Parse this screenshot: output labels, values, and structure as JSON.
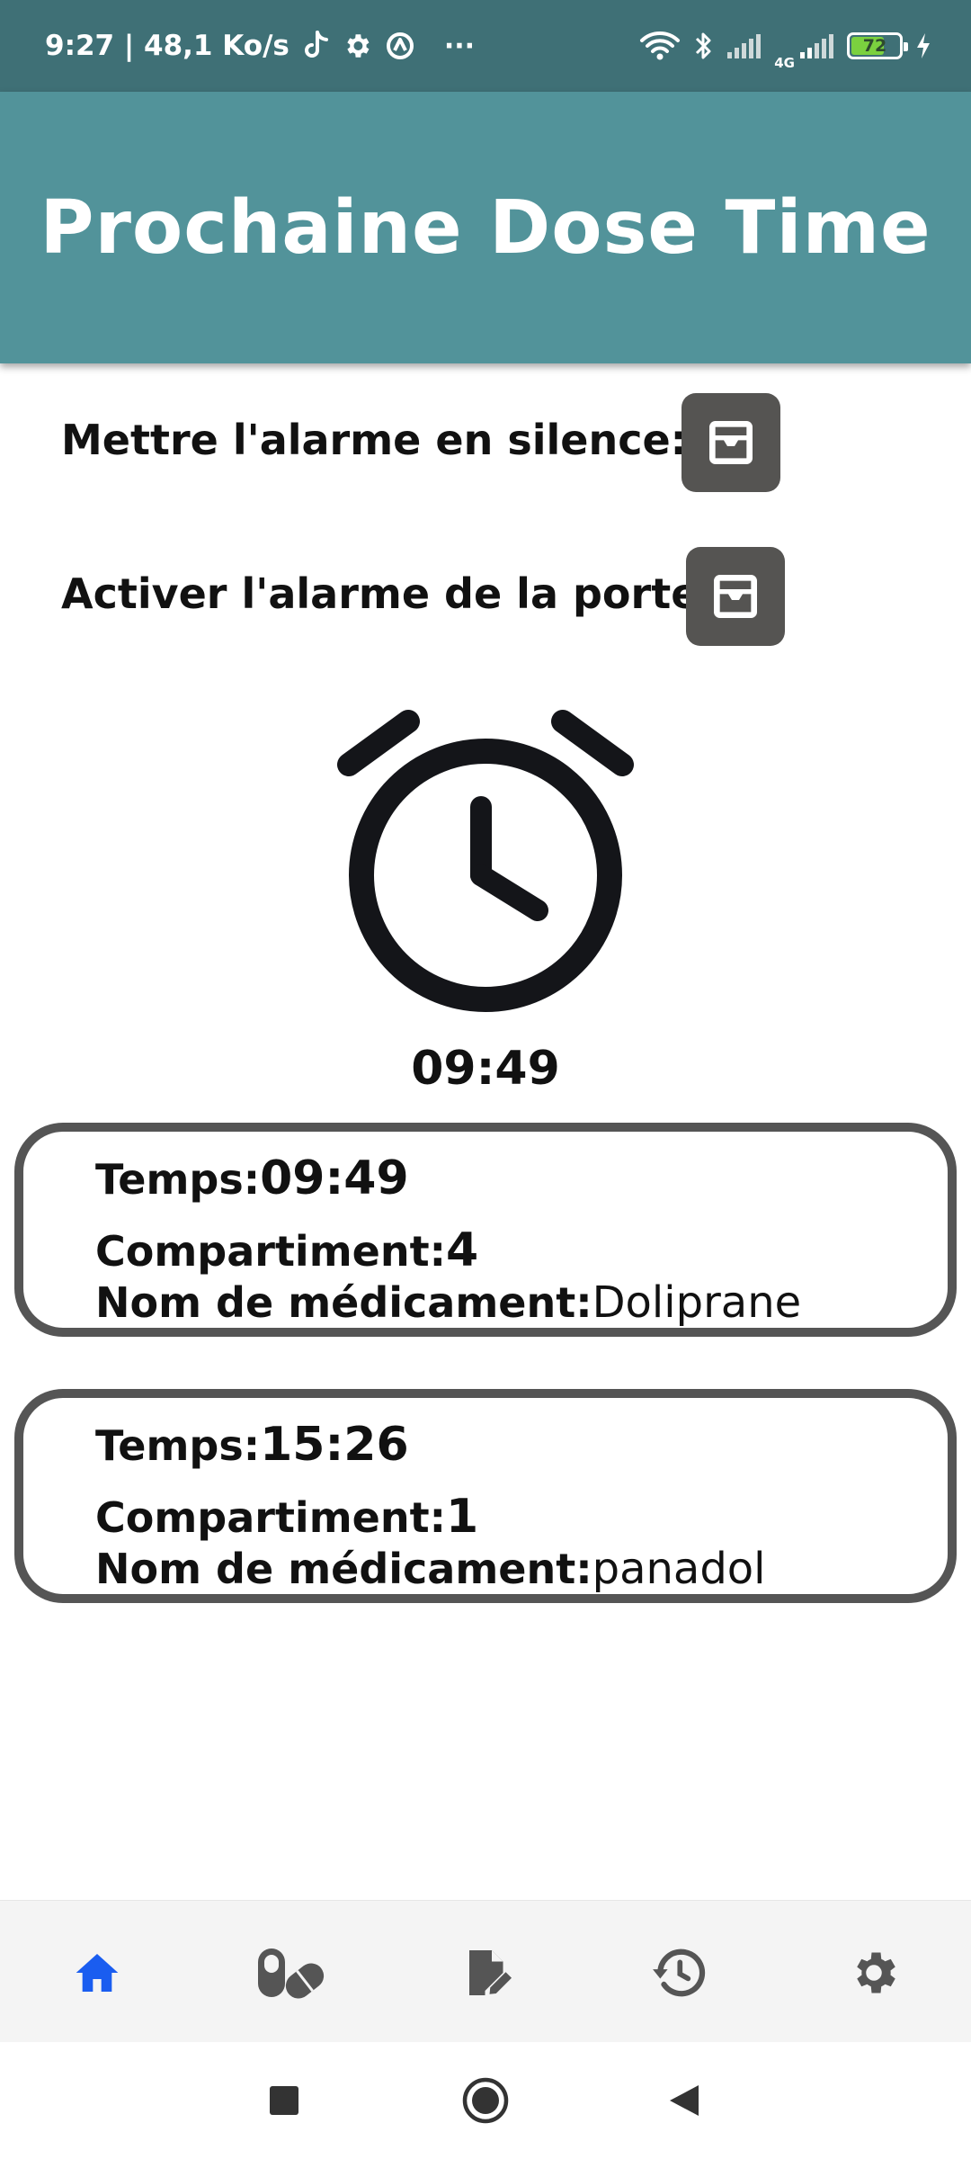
{
  "status_bar": {
    "time_speed": "9:27 | 48,1 Ko/s",
    "more": "···",
    "network_label": "4G",
    "battery_level": "72",
    "battery_fraction": 0.72,
    "battery_color": "#7bd13f"
  },
  "app_bar": {
    "title": "Prochaine Dose Time",
    "color": "#52939a"
  },
  "controls": {
    "silence_label": "Mettre l'alarme en silence:",
    "door_label": "Activer l'alarme de la porte :"
  },
  "clock": {
    "icon": "alarm-clock-icon",
    "time": "09:49"
  },
  "doses": [
    {
      "time_label": "Temps:",
      "time": "09:49",
      "compartment_label": "Compartiment:",
      "compartment": "4",
      "name_label": "Nom de médicament:",
      "name": "Doliprane"
    },
    {
      "time_label": "Temps:",
      "time": "15:26",
      "compartment_label": "Compartiment:",
      "compartment": "1",
      "name_label": "Nom de médicament:",
      "name": "panadol"
    }
  ],
  "bottom_nav": {
    "active_color": "#1a5df0",
    "inactive_color": "#555555",
    "items": [
      {
        "icon": "home-icon",
        "active": true
      },
      {
        "icon": "pills-icon",
        "active": false
      },
      {
        "icon": "edit-document-icon",
        "active": false
      },
      {
        "icon": "history-icon",
        "active": false
      },
      {
        "icon": "settings-gear-icon",
        "active": false
      }
    ]
  },
  "system_nav": {
    "buttons": [
      "recents-square-icon",
      "home-circle-icon",
      "back-triangle-icon"
    ]
  }
}
